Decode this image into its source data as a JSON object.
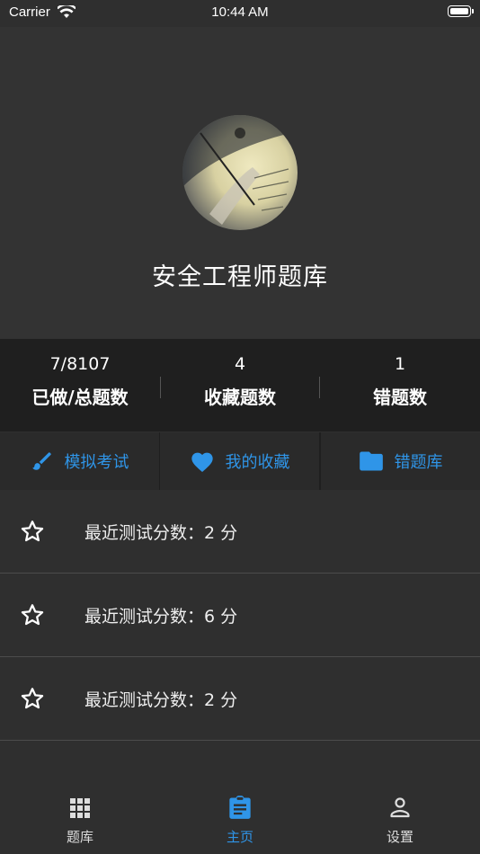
{
  "status_bar": {
    "carrier": "Carrier",
    "time": "10:44 AM"
  },
  "header": {
    "title": "安全工程师题库"
  },
  "stats": [
    {
      "value": "7/8107",
      "label": "已做/总题数"
    },
    {
      "value": "4",
      "label": "收藏题数"
    },
    {
      "value": "1",
      "label": "错题数"
    }
  ],
  "actions": [
    {
      "label": "模拟考试",
      "icon": "brush-icon"
    },
    {
      "label": "我的收藏",
      "icon": "heart-icon"
    },
    {
      "label": "错题库",
      "icon": "folder-icon"
    }
  ],
  "scores": [
    {
      "text": "最近测试分数：2 分"
    },
    {
      "text": "最近测试分数：6 分"
    },
    {
      "text": "最近测试分数：2 分"
    }
  ],
  "tabbar": {
    "tabs": [
      {
        "label": "题库",
        "icon": "grid-icon",
        "active": false
      },
      {
        "label": "主页",
        "icon": "clipboard-icon",
        "active": true
      },
      {
        "label": "设置",
        "icon": "person-icon",
        "active": false
      }
    ]
  },
  "colors": {
    "accent": "#2f95e8",
    "background": "#2f2f2f",
    "panel": "#1f1f1f"
  }
}
